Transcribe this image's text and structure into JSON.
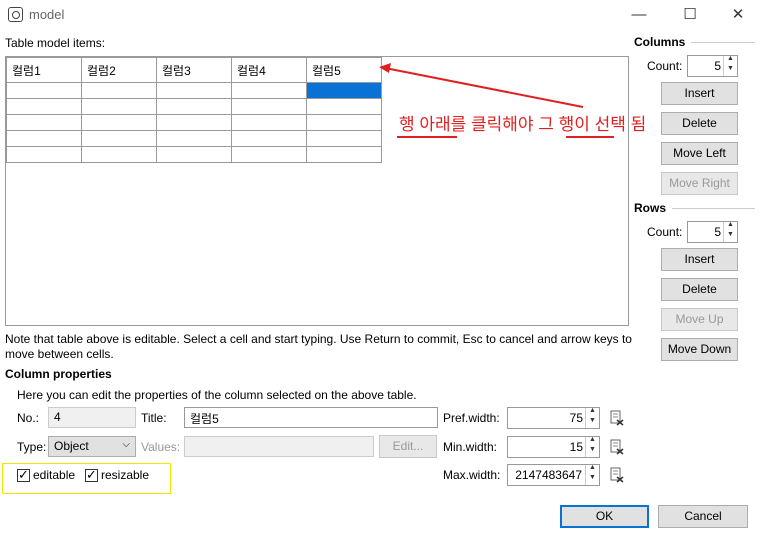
{
  "window": {
    "title": "model",
    "controls": {
      "minimize": "—",
      "maximize": "☐",
      "close": "✕"
    }
  },
  "table_section": {
    "label": "Table model items:",
    "headers": [
      "컬럼1",
      "컬럼2",
      "컬럼3",
      "컬럼4",
      "컬럼5"
    ],
    "empty_rows": 5,
    "selected_cell": {
      "row": 0,
      "col": 4
    }
  },
  "annotation": {
    "text": "행 아래를 클릭해야 그 행이 선택 됨",
    "color": "#e02020"
  },
  "columns": {
    "title": "Columns",
    "count_label": "Count:",
    "count": "5",
    "insert": "Insert",
    "delete": "Delete",
    "move_left": "Move Left",
    "move_right": "Move Right"
  },
  "rows": {
    "title": "Rows",
    "count_label": "Count:",
    "count": "5",
    "insert": "Insert",
    "delete": "Delete",
    "move_up": "Move Up",
    "move_down": "Move Down"
  },
  "note": "Note that table above is editable. Select a cell and start typing. Use Return to commit, Esc to cancel and arrow keys to move between cells.",
  "column_properties": {
    "title": "Column properties",
    "hint": "Here you can edit the properties of the column selected on the above table.",
    "no_label": "No.:",
    "no_value": "4",
    "title_label": "Title:",
    "title_value": "컬럼5",
    "type_label": "Type:",
    "type_value": "Object",
    "values_label": "Values:",
    "values_value": "",
    "edit_button": "Edit...",
    "pref_width_label": "Pref.width:",
    "pref_width": "75",
    "min_width_label": "Min.width:",
    "min_width": "15",
    "max_width_label": "Max.width:",
    "max_width": "2147483647",
    "editable_label": "editable",
    "editable": true,
    "resizable_label": "resizable",
    "resizable": true
  },
  "footer": {
    "ok": "OK",
    "cancel": "Cancel"
  },
  "colors": {
    "accent": "#0a72d4",
    "highlight_box": "#f2e600"
  }
}
